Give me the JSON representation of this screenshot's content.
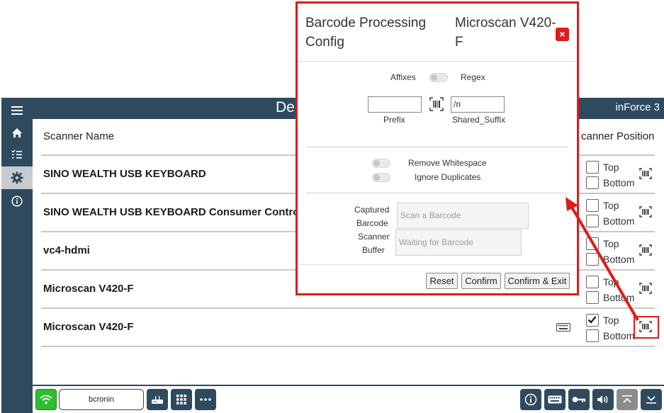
{
  "app": {
    "title": "De",
    "brand": "inForce 3",
    "sidebar": [
      {
        "icon": "menu-icon"
      },
      {
        "icon": "home-icon"
      },
      {
        "icon": "list-icon"
      },
      {
        "icon": "gear-icon",
        "active": true
      },
      {
        "icon": "info-icon"
      }
    ]
  },
  "table": {
    "col_scanner_name": "Scanner Name",
    "col_scanner_position": "canner Position",
    "rows": [
      {
        "name": "SINO WEALTH USB KEYBOARD",
        "top_label": "Top",
        "bottom_label": "Bottom",
        "top_checked": false
      },
      {
        "name": "SINO WEALTH USB KEYBOARD Consumer Control",
        "top_label": "Top",
        "bottom_label": "Bottom",
        "top_checked": false
      },
      {
        "name": "vc4-hdmi",
        "top_label": "Top",
        "bottom_label": "Bottom",
        "top_checked": false
      },
      {
        "name": "Microscan V420-F",
        "top_label": "Top",
        "bottom_label": "Bottom",
        "top_checked": false
      },
      {
        "name": "Microscan V420-F",
        "top_label": "Top",
        "bottom_label": "Bottom",
        "top_checked": true
      }
    ]
  },
  "bottombar": {
    "user": "bcronin"
  },
  "modal": {
    "title": "Barcode Processing Config",
    "subtitle": "Microscan V420-F",
    "close": "×",
    "affixes_label": "Affixes",
    "regex_label": "Regex",
    "prefix_value": "",
    "prefix_label": "Prefix",
    "suffix_value": "/n",
    "suffix_label": "Shared_Suffix",
    "remove_whitespace": "Remove Whitespace",
    "ignore_duplicates": "Ignore Duplicates",
    "captured_barcode_label_1": "Captured",
    "captured_barcode_label_2": "Barcode",
    "scanner_buffer_label_1": "Scanner",
    "scanner_buffer_label_2": "Buffer",
    "captured_barcode_placeholder": "Scan a Barcode",
    "scanner_buffer_placeholder": "Waiting for Barcode",
    "reset": "Reset",
    "confirm": "Confirm",
    "confirm_exit": "Confirm & Exit"
  },
  "colors": {
    "navy": "#2e4a5f",
    "annotation_red": "#e01b1b",
    "wifi_green": "#2ebd2e"
  }
}
